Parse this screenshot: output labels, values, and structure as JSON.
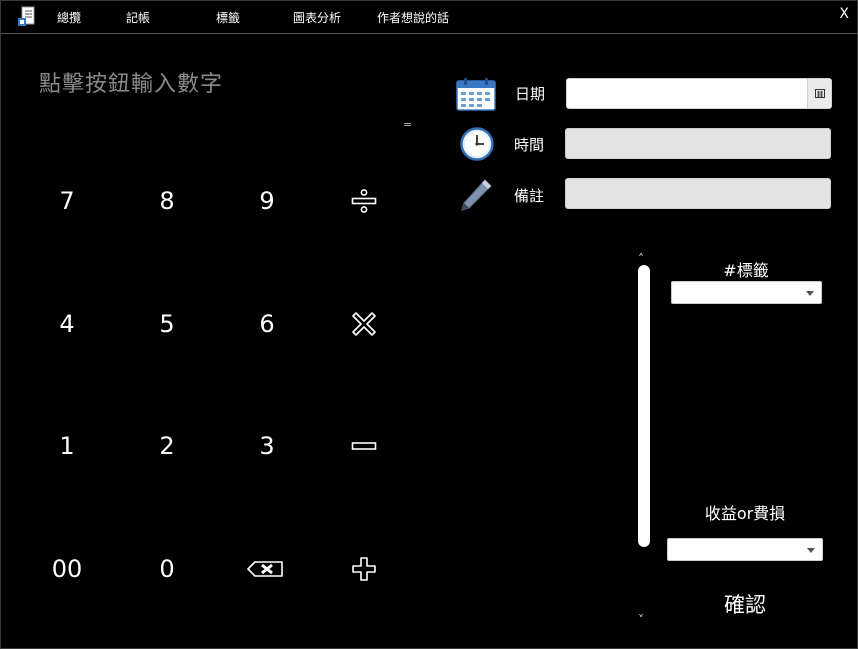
{
  "menu": {
    "items": [
      "總攬",
      "記帳",
      "標籤",
      "圖表分析",
      "作者想說的話"
    ],
    "close": "X"
  },
  "calculator": {
    "prompt": "點擊按鈕輸入數字",
    "equals": "=",
    "keys": {
      "k7": "7",
      "k8": "8",
      "k9": "9",
      "k4": "4",
      "k5": "5",
      "k6": "6",
      "k1": "1",
      "k2": "2",
      "k3": "3",
      "k00": "00",
      "k0": "0"
    },
    "operator_icons": [
      "divide-icon",
      "multiply-icon",
      "minus-icon",
      "plus-icon",
      "backspace-icon"
    ]
  },
  "form": {
    "date_label": "日期",
    "time_label": "時間",
    "note_label": "備註",
    "date_value": "",
    "time_value": "",
    "note_value": ""
  },
  "side": {
    "scroll_up": "˄",
    "scroll_down": "˅",
    "tag_label": "#標籤",
    "tag_value": "",
    "income_label": "收益or費損",
    "income_value": "",
    "confirm": "確認"
  },
  "colors": {
    "background": "#000000",
    "prompt_text": "#8a8a8a",
    "input_fill": "#e3e3e3",
    "clock_face": "#2f6fb3",
    "calendar": "#3b78c4"
  }
}
